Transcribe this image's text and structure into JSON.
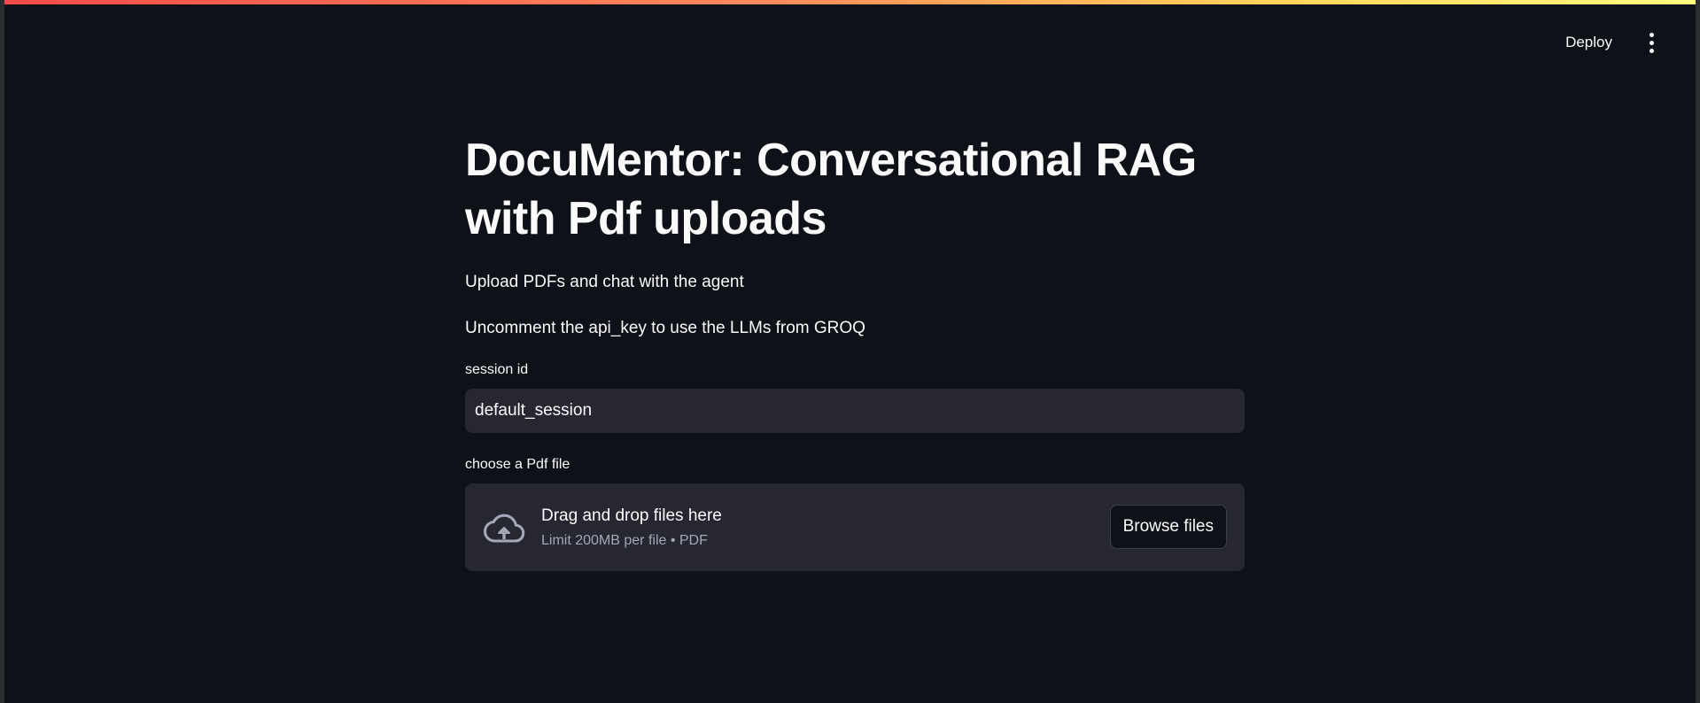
{
  "header": {
    "deploy_label": "Deploy",
    "menu_icon": "kebab-menu-icon"
  },
  "main": {
    "title": "DocuMentor: Conversational RAG with Pdf uploads",
    "paragraphs": [
      "Upload PDFs and chat with the agent",
      "Uncomment the api_key to use the LLMs from GROQ"
    ],
    "session_field": {
      "label": "session id",
      "value": "default_session"
    },
    "uploader": {
      "label": "choose a Pdf file",
      "icon": "cloud-upload-icon",
      "instruction": "Drag and drop files here",
      "limit_text": "Limit 200MB per file • PDF",
      "browse_label": "Browse files"
    }
  },
  "colors": {
    "background": "#0e1117",
    "input_bg": "#262730",
    "text": "#fafafa",
    "muted_text": "#a3a8b8",
    "accent_gradient_start": "#ff4b4b",
    "accent_gradient_end": "#fffd80"
  }
}
